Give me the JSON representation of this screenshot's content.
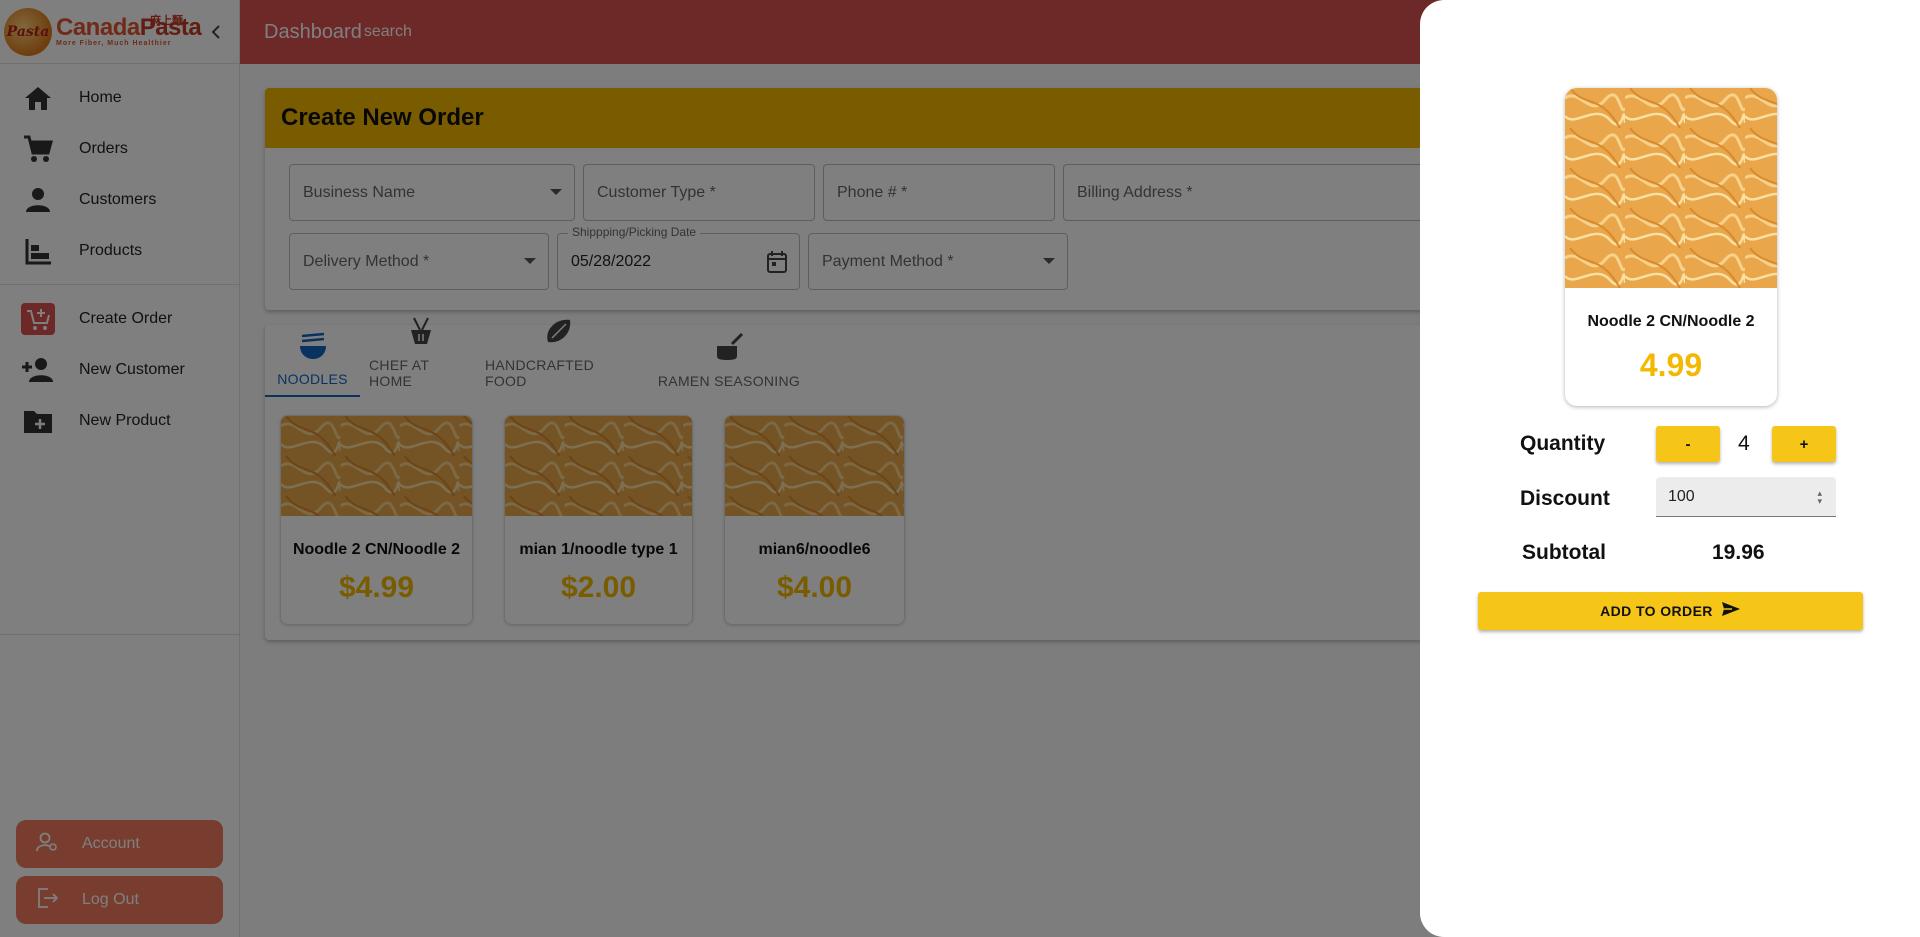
{
  "brand": {
    "logo_badge": "Pasta",
    "name_part1": "Canada",
    "name_part2": "Pasta",
    "chinese": "麻上麵",
    "tagline": "More Fiber, Much Healthier"
  },
  "topbar": {
    "title": "Dashboard",
    "search": "search"
  },
  "sidebar": {
    "items": [
      {
        "label": "Home",
        "icon": "home-icon"
      },
      {
        "label": "Orders",
        "icon": "cart-icon"
      },
      {
        "label": "Customers",
        "icon": "person-icon"
      },
      {
        "label": "Products",
        "icon": "products-icon"
      },
      {
        "label": "Create Order",
        "icon": "create-order-icon"
      },
      {
        "label": "New Customer",
        "icon": "add-person-icon"
      },
      {
        "label": "New Product",
        "icon": "new-folder-icon"
      }
    ],
    "account_label": "Account",
    "logout_label": "Log Out"
  },
  "order": {
    "title": "Create New Order",
    "business_name": "Business Name",
    "customer_type": "Customer Type *",
    "phone": "Phone # *",
    "billing_address": "Billing Address *",
    "delivery_method": "Delivery Method *",
    "shipping_date_label": "Shippping/Picking Date",
    "shipping_date_value": "05/28/2022",
    "payment_method": "Payment Method *"
  },
  "tabs": [
    {
      "label": "NOODLES",
      "icon": "noodle-bowl-icon",
      "active": true
    },
    {
      "label": "CHEF AT HOME",
      "icon": "chef-icon",
      "active": false
    },
    {
      "label": "HANDCRAFTED FOOD",
      "icon": "dumpling-icon",
      "active": false
    },
    {
      "label": "RAMEN SEASONING",
      "icon": "pot-icon",
      "active": false
    }
  ],
  "products": [
    {
      "name": "Noodle 2 CN/Noodle 2",
      "price": "$4.99"
    },
    {
      "name": "mian 1/noodle type 1",
      "price": "$2.00"
    },
    {
      "name": "mian6/noodle6",
      "price": "$4.00"
    }
  ],
  "drawer": {
    "product_name": "Noodle 2 CN/Noodle 2",
    "product_price": "4.99",
    "quantity_label": "Quantity",
    "decrement": "-",
    "quantity": "4",
    "increment": "+",
    "discount_label": "Discount",
    "discount_value": "100",
    "subtotal_label": "Subtotal",
    "subtotal_value": "19.96",
    "add_button": "ADD TO ORDER"
  },
  "colors": {
    "topbar": "#d9534f",
    "accent_yellow": "#f5b800",
    "sidebar_button": "#f07a5e",
    "tab_active": "#1565c0"
  }
}
